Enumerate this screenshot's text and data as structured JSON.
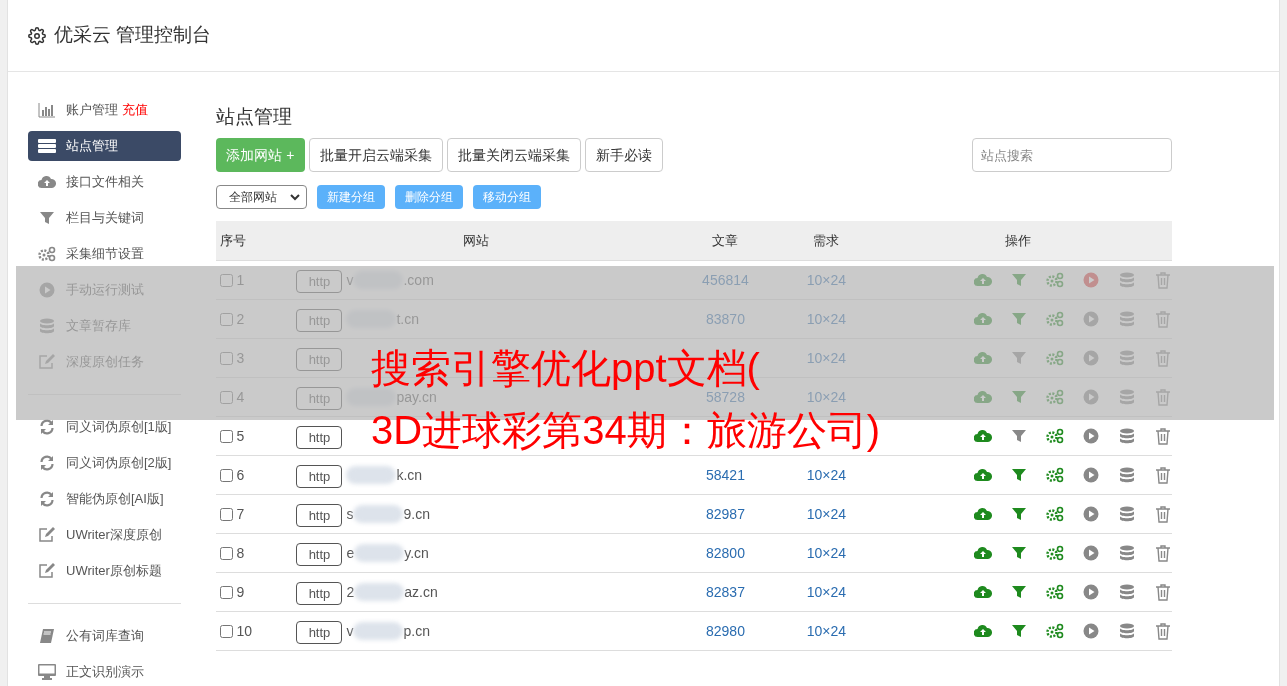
{
  "header": {
    "title": "优采云 管理控制台"
  },
  "sidebar": {
    "groups": [
      {
        "items": [
          {
            "kind": "chart",
            "label": "账户管理",
            "badge": "充值",
            "selected": false
          },
          {
            "kind": "server",
            "label": "站点管理",
            "selected": true
          },
          {
            "kind": "cloud",
            "label": "接口文件相关",
            "selected": false
          },
          {
            "kind": "filter",
            "label": "栏目与关键词",
            "selected": false
          },
          {
            "kind": "gears",
            "label": "采集细节设置",
            "selected": false
          },
          {
            "kind": "play",
            "label": "手动运行测试",
            "selected": false
          },
          {
            "kind": "database",
            "label": "文章暂存库",
            "selected": false
          },
          {
            "kind": "edit",
            "label": "深度原创任务",
            "selected": false
          }
        ]
      },
      {
        "items": [
          {
            "kind": "refresh",
            "label": "同义词伪原创[1版]",
            "selected": false
          },
          {
            "kind": "refresh",
            "label": "同义词伪原创[2版]",
            "selected": false
          },
          {
            "kind": "refresh",
            "label": "智能伪原创[AI版]",
            "selected": false
          },
          {
            "kind": "edit",
            "label": "UWriter深度原创",
            "selected": false
          },
          {
            "kind": "edit",
            "label": "UWriter原创标题",
            "selected": false
          }
        ]
      },
      {
        "items": [
          {
            "kind": "book",
            "label": "公有词库查询",
            "selected": false
          },
          {
            "kind": "monitor",
            "label": "正文识别演示",
            "selected": false
          }
        ]
      }
    ]
  },
  "main": {
    "title": "站点管理",
    "buttons": [
      {
        "label": "添加网站 +",
        "kind": "primary"
      },
      {
        "label": "批量开启云端采集",
        "kind": "default"
      },
      {
        "label": "批量关闭云端采集",
        "kind": "default"
      },
      {
        "label": "新手必读",
        "kind": "default"
      }
    ],
    "search": {
      "placeholder": "站点搜索"
    },
    "group_select": {
      "value": "全部网站"
    },
    "group_buttons": [
      "新建分组",
      "删除分组",
      "移动分组"
    ],
    "table": {
      "columns": [
        "序号",
        "网站",
        "文章",
        "需求",
        "操作"
      ],
      "rows": [
        {
          "checked": false,
          "index": "1",
          "scheme": "http",
          "domain_start": "v",
          "domain_end": ".com",
          "articles": "456814",
          "demand": "10×24",
          "filter_on": true,
          "running": true
        },
        {
          "checked": false,
          "index": "2",
          "scheme": "http",
          "domain_end": "t.cn",
          "articles": "83870",
          "demand": "10×24",
          "filter_on": true,
          "running": false
        },
        {
          "checked": false,
          "index": "3",
          "scheme": "http",
          "demand": "10×24",
          "filter_on": false,
          "running": false
        },
        {
          "checked": false,
          "index": "4",
          "scheme": "http",
          "domain_end": "pay.cn",
          "articles": "58728",
          "demand": "10×24",
          "filter_on": true,
          "running": false
        },
        {
          "checked": false,
          "index": "5",
          "scheme": "http",
          "filter_on": false,
          "running": false
        },
        {
          "checked": false,
          "index": "6",
          "scheme": "http",
          "domain_end": "k.cn",
          "articles": "58421",
          "demand": "10×24",
          "filter_on": true,
          "running": false
        },
        {
          "checked": false,
          "index": "7",
          "scheme": "http",
          "domain_start": "s",
          "domain_end": "9.cn",
          "articles": "82987",
          "demand": "10×24",
          "filter_on": true,
          "running": false
        },
        {
          "checked": false,
          "index": "8",
          "scheme": "http",
          "domain_start": "e",
          "domain_end": "y.cn",
          "articles": "82800",
          "demand": "10×24",
          "filter_on": true,
          "running": false
        },
        {
          "checked": false,
          "index": "9",
          "scheme": "http",
          "domain_start": "2",
          "domain_end": "az.cn",
          "articles": "82837",
          "demand": "10×24",
          "filter_on": true,
          "running": false
        },
        {
          "checked": false,
          "index": "10",
          "scheme": "http",
          "domain_start": "v",
          "domain_end": "p.cn",
          "articles": "82980",
          "demand": "10×24",
          "filter_on": true,
          "running": false
        }
      ]
    }
  },
  "overlay": {
    "lines": [
      "搜索引擎优化ppt文档(",
      "3D进球彩第34期：旅游公司)"
    ]
  }
}
